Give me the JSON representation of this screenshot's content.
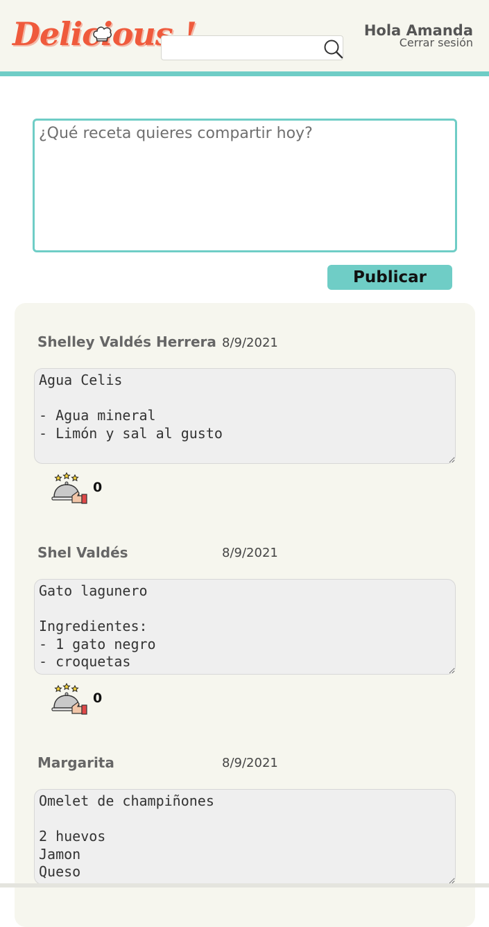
{
  "header": {
    "logo_text": "Delicious !",
    "search": {
      "placeholder": "",
      "value": ""
    },
    "greeting": "Hola Amanda",
    "logout_label": "Cerrar sesión"
  },
  "composer": {
    "placeholder": "¿Qué receta quieres compartir hoy?",
    "value": ""
  },
  "publish_label": "Publicar",
  "posts": [
    {
      "author": "Shelley Valdés Herrera",
      "date": "8/9/2021",
      "body": "Agua Celis\n\n- Agua mineral\n- Limón y sal al gusto",
      "likes": "0"
    },
    {
      "author": "Shel Valdés",
      "date": "8/9/2021",
      "body": "Gato lagunero\n\nIngredientes:\n- 1 gato negro\n- croquetas",
      "likes": "0"
    },
    {
      "author": "Margarita",
      "date": "8/9/2021",
      "body": "Omelet de champiñones\n\n2 huevos\nJamon\nQueso",
      "likes": ""
    }
  ],
  "colors": {
    "accent": "#6fcdc6",
    "logo": "#ef5a3c",
    "feed_background": "#f6f6ee"
  },
  "icons": [
    "chef-hat-icon",
    "search-icon",
    "cloche-thumbs-up-icon"
  ]
}
